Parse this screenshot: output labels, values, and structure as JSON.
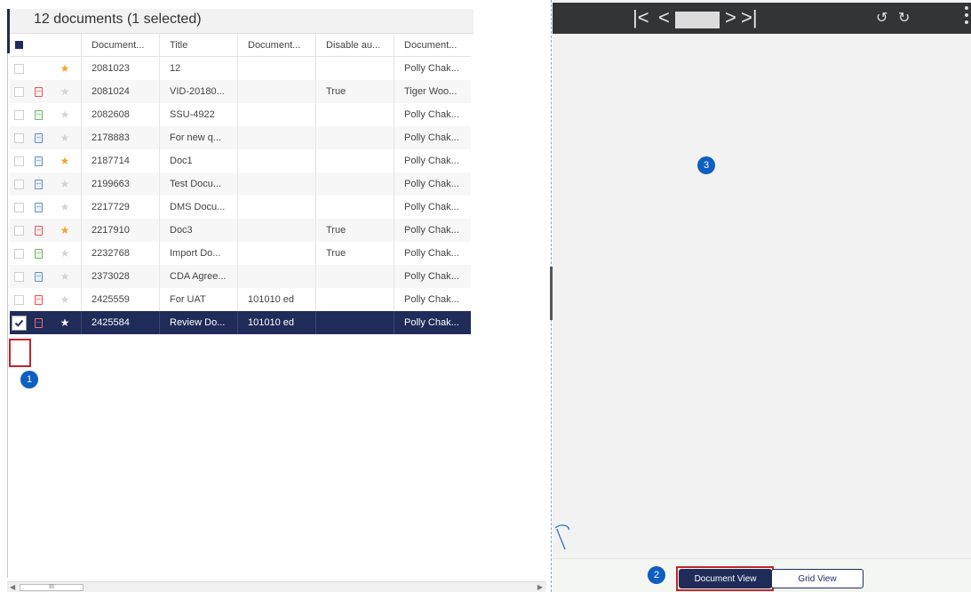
{
  "list": {
    "count_label": "12 documents (1 selected)",
    "columns": [
      "Document...",
      "Title",
      "Document...",
      "Disable au...",
      "Document..."
    ],
    "rows": [
      {
        "type": "none",
        "starred": true,
        "id": "2081023",
        "title": "12",
        "doc": "",
        "disable": "",
        "owner": "Polly Chak..."
      },
      {
        "type": "pdf",
        "starred": false,
        "id": "2081024",
        "title": "VID-20180...",
        "doc": "",
        "disable": "True",
        "owner": "Tiger Woo..."
      },
      {
        "type": "img",
        "starred": false,
        "id": "2082608",
        "title": "SSU-4922",
        "doc": "",
        "disable": "",
        "owner": "Polly Chak..."
      },
      {
        "type": "word",
        "starred": false,
        "id": "2178883",
        "title": "For new q...",
        "doc": "",
        "disable": "",
        "owner": "Polly Chak..."
      },
      {
        "type": "word",
        "starred": true,
        "id": "2187714",
        "title": "Doc1",
        "doc": "",
        "disable": "",
        "owner": "Polly Chak..."
      },
      {
        "type": "word",
        "starred": false,
        "id": "2199663",
        "title": "Test Docu...",
        "doc": "",
        "disable": "",
        "owner": "Polly Chak..."
      },
      {
        "type": "word",
        "starred": false,
        "id": "2217729",
        "title": "DMS Docu...",
        "doc": "",
        "disable": "",
        "owner": "Polly Chak..."
      },
      {
        "type": "pdf",
        "starred": true,
        "id": "2217910",
        "title": "Doc3",
        "doc": "",
        "disable": "True",
        "owner": "Polly Chak..."
      },
      {
        "type": "img",
        "starred": false,
        "id": "2232768",
        "title": "Import Do...",
        "doc": "",
        "disable": "True",
        "owner": "Polly Chak..."
      },
      {
        "type": "word",
        "starred": false,
        "id": "2373028",
        "title": "CDA Agree...",
        "doc": "",
        "disable": "",
        "owner": "Polly Chak..."
      },
      {
        "type": "pdf",
        "starred": false,
        "id": "2425559",
        "title": "For UAT",
        "doc": "101010 ed",
        "disable": "",
        "owner": "Polly Chak..."
      },
      {
        "type": "pdf",
        "starred": true,
        "id": "2425584",
        "title": "Review Do...",
        "doc": "101010 ed",
        "disable": "",
        "owner": "Polly Chak...",
        "selected": true
      }
    ]
  },
  "badges": {
    "one": "1",
    "two": "2",
    "three": "3"
  },
  "scrollbar": {
    "thumb_label": "III"
  },
  "viewer": {
    "toolbar": {
      "first": "|<",
      "prev": "<",
      "next": ">",
      "last": ">|"
    }
  },
  "footer": {
    "document_view_label": "Document View",
    "grid_view_label": "Grid View"
  },
  "colors": {
    "accent": "#1f2c5a",
    "badge": "#0d5fc1",
    "highlight": "#c0262c",
    "star": "#f3a530"
  }
}
